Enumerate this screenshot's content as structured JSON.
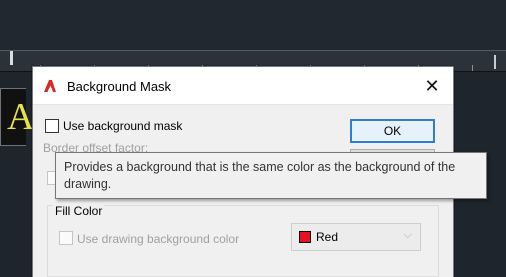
{
  "dialog": {
    "title": "Background Mask",
    "close_glyph": "✕",
    "use_mask_label": "Use background mask",
    "use_mask_checked": false,
    "border_offset_label": "Border offset factor:",
    "ok_label": "OK",
    "fill_color_group_label": "Fill Color",
    "use_drawing_bg_label": "Use drawing background color",
    "use_drawing_bg_checked": false,
    "color_select": {
      "selected": "Red",
      "swatch_color": "#e81123"
    }
  },
  "tooltip": {
    "text": "Provides a background that is the same color as the background of the drawing."
  },
  "background": {
    "canvas_glyph": "A",
    "canvas_glyph_color": "#e6e24a"
  },
  "icons": {
    "app": "autocad-logo-icon",
    "close": "close-icon",
    "dropdown": "chevron-down-icon"
  }
}
